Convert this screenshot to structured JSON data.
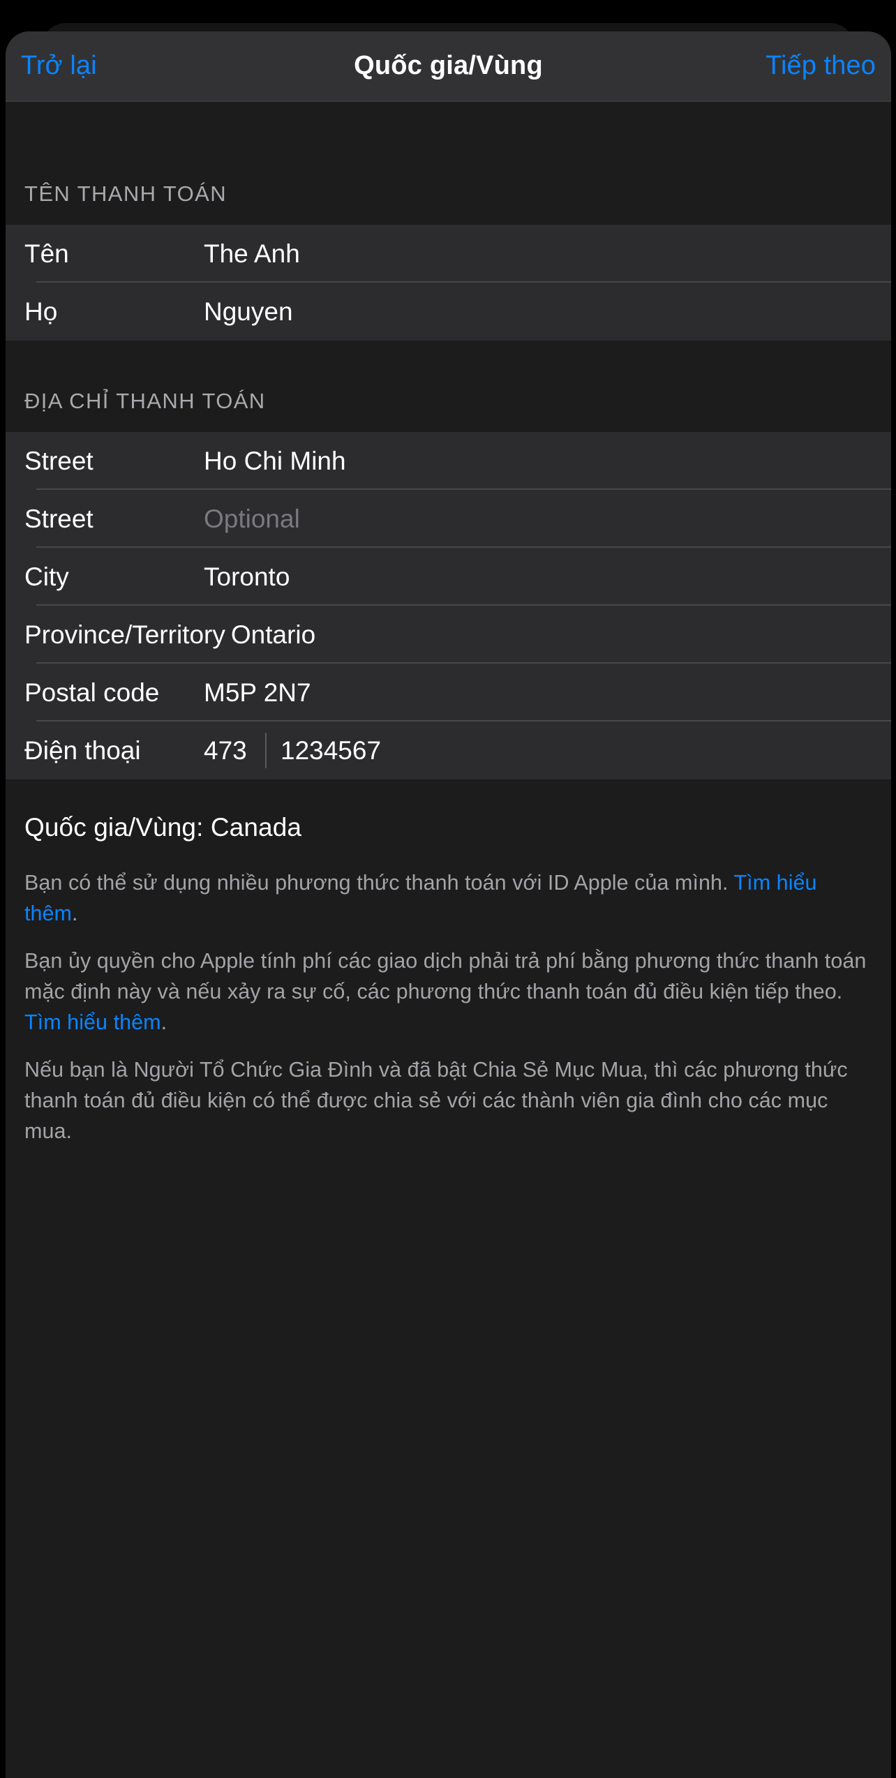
{
  "navbar": {
    "back_label": "Trở lại",
    "title": "Quốc gia/Vùng",
    "next_label": "Tiếp theo"
  },
  "sections": {
    "billing_name": {
      "header": "TÊN THANH TOÁN",
      "rows": [
        {
          "label": "Tên",
          "value": "The Anh"
        },
        {
          "label": "Họ",
          "value": "Nguyen"
        }
      ]
    },
    "billing_address": {
      "header": "ĐỊA CHỈ THANH TOÁN",
      "rows": [
        {
          "label": "Street",
          "value": "Ho Chi Minh"
        },
        {
          "label": "Street",
          "value": "Optional"
        },
        {
          "label": "City",
          "value": "Toronto"
        },
        {
          "label": "Province/Territory",
          "value": "Ontario"
        },
        {
          "label": "Postal code",
          "value": "M5P 2N7"
        }
      ],
      "phone_row": {
        "label": "Điện thoại",
        "country_code": "473",
        "number": "1234567"
      }
    }
  },
  "footer": {
    "country_line": "Quốc gia/Vùng: Canada",
    "paragraph1_before": "Bạn có thể sử dụng nhiều phương thức thanh toán với ID Apple của mình. ",
    "paragraph1_link": "Tìm hiểu thêm",
    "paragraph1_after": ".",
    "paragraph2_before": "Bạn ủy quyền cho Apple tính phí các giao dịch phải trả phí bằng phương thức thanh toán mặc định này và nếu xảy ra sự cố, các phương thức thanh toán đủ điều kiện tiếp theo. ",
    "paragraph2_link": "Tìm hiểu thêm",
    "paragraph2_after": ".",
    "paragraph3": "Nếu bạn là Người Tổ Chức Gia Đình và đã bật Chia Sẻ Mục Mua, thì các phương thức thanh toán đủ điều kiện có thể được chia sẻ với các thành viên gia đình cho các mục mua."
  },
  "colors": {
    "accent": "#0a84ff",
    "sheet_background": "#1c1c1c",
    "row_background": "#2c2c2e",
    "navbar_background": "#323234",
    "separator": "#48484a",
    "secondary_text": "#a3a3a8",
    "placeholder_text": "#7a7a7e"
  }
}
